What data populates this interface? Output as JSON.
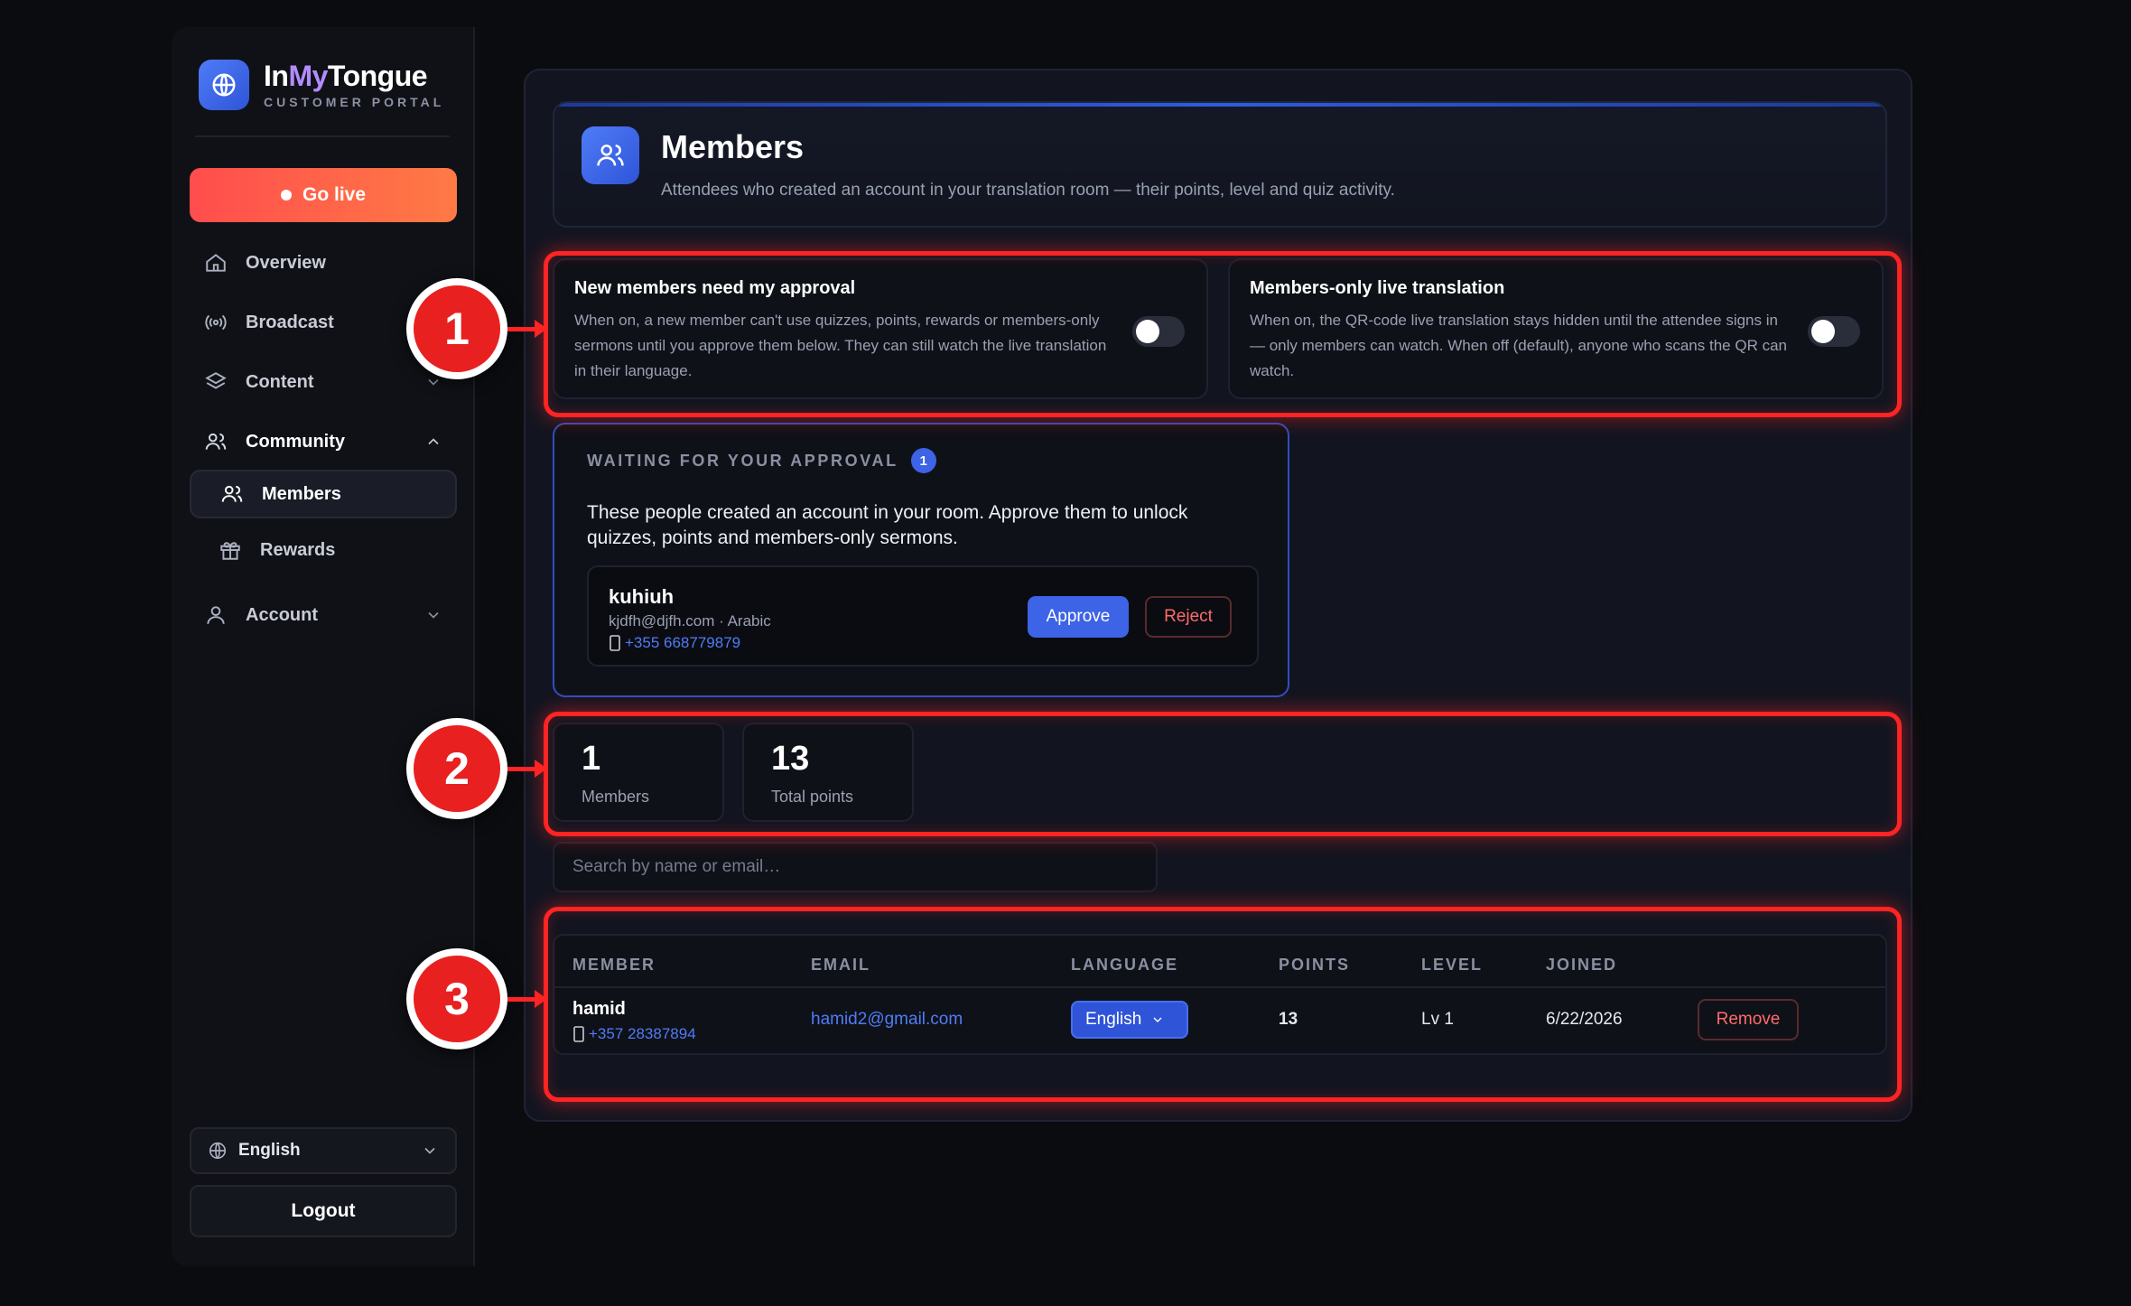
{
  "brand": {
    "name_prefix": "In",
    "name_highlight": "My",
    "name_suffix": "Tongue",
    "subtitle": "CUSTOMER PORTAL"
  },
  "sidebar": {
    "go_live": "Go live",
    "items": [
      {
        "label": "Overview",
        "icon": "home-icon"
      },
      {
        "label": "Broadcast",
        "icon": "broadcast-icon"
      },
      {
        "label": "Content",
        "icon": "layers-icon"
      },
      {
        "label": "Community",
        "icon": "users-icon"
      },
      {
        "label": "Members",
        "icon": "users-icon"
      },
      {
        "label": "Rewards",
        "icon": "gift-icon"
      },
      {
        "label": "Account",
        "icon": "user-icon"
      }
    ],
    "language": "English",
    "logout": "Logout"
  },
  "header": {
    "title": "Members",
    "subtitle": "Attendees who created an account in your translation room — their points, level and quiz activity."
  },
  "settings": [
    {
      "title": "New members need my approval",
      "description": "When on, a new member can't use quizzes, points, rewards or members-only sermons until you approve them below. They can still watch the live translation in their language.",
      "enabled": false
    },
    {
      "title": "Members-only live translation",
      "description": "When on, the QR-code live translation stays hidden until the attendee signs in — only members can watch. When off (default), anyone who scans the QR can watch.",
      "enabled": false
    }
  ],
  "approval": {
    "label": "WAITING FOR YOUR APPROVAL",
    "count": "1",
    "text": "These people created an account in your room. Approve them to unlock quizzes, points and members-only sermons.",
    "pending": {
      "name": "kuhiuh",
      "meta": "kjdfh@djfh.com · Arabic",
      "phone": "+355 668779879"
    },
    "approve_label": "Approve",
    "reject_label": "Reject"
  },
  "stats": [
    {
      "value": "1",
      "label": "Members"
    },
    {
      "value": "13",
      "label": "Total points"
    }
  ],
  "search": {
    "placeholder": "Search by name or email…"
  },
  "table": {
    "columns": [
      "MEMBER",
      "EMAIL",
      "LANGUAGE",
      "POINTS",
      "LEVEL",
      "JOINED"
    ],
    "rows": [
      {
        "name": "hamid",
        "phone": "+357 28387894",
        "email": "hamid2@gmail.com",
        "language": "English",
        "points": "13",
        "level": "Lv 1",
        "joined": "6/22/2026",
        "action": "Remove"
      }
    ]
  },
  "annotations": [
    "1",
    "2",
    "3"
  ],
  "colors": {
    "accent": "#3d63e6",
    "danger": "#ff2424",
    "golive_start": "#ff4d4d",
    "golive_end": "#ff7a45"
  }
}
